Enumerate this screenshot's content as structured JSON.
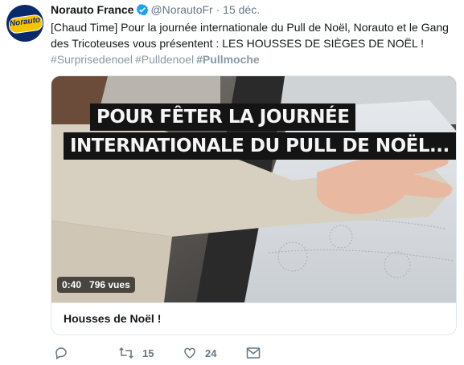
{
  "account": {
    "name": "Norauto France",
    "handle": "@NorautoFr",
    "separator": "·",
    "date": "15 déc.",
    "avatar_text": "Norauto"
  },
  "tweet": {
    "text": "[Chaud Time] Pour la journée internationale du Pull de Noël, Norauto et le Gang des Tricoteuses vous présentent : LES HOUSSES DE SIÈGES DE NOËL !",
    "hashtags": [
      {
        "text": "#Surprisedenoel"
      },
      {
        "text": "#Pulldenoel"
      },
      {
        "text": "#Pullmoche"
      }
    ]
  },
  "card": {
    "caption_line1": "POUR FÊTER LA JOURNÉE",
    "caption_line2": "INTERNATIONALE DU PULL DE NOËL...",
    "duration": "0:40",
    "views": "796 vues",
    "title": "Housses de Noël !"
  },
  "actions": {
    "reply_count": "",
    "retweet_count": "15",
    "like_count": "24"
  },
  "colors": {
    "text_primary": "#14171a",
    "text_muted": "#657786",
    "hashtag": "#8899a6",
    "verified": "#1da1f2",
    "border": "#e1e8ed"
  },
  "icons": [
    "verified-badge-icon",
    "reply-icon",
    "retweet-icon",
    "like-icon",
    "direct-message-icon"
  ]
}
